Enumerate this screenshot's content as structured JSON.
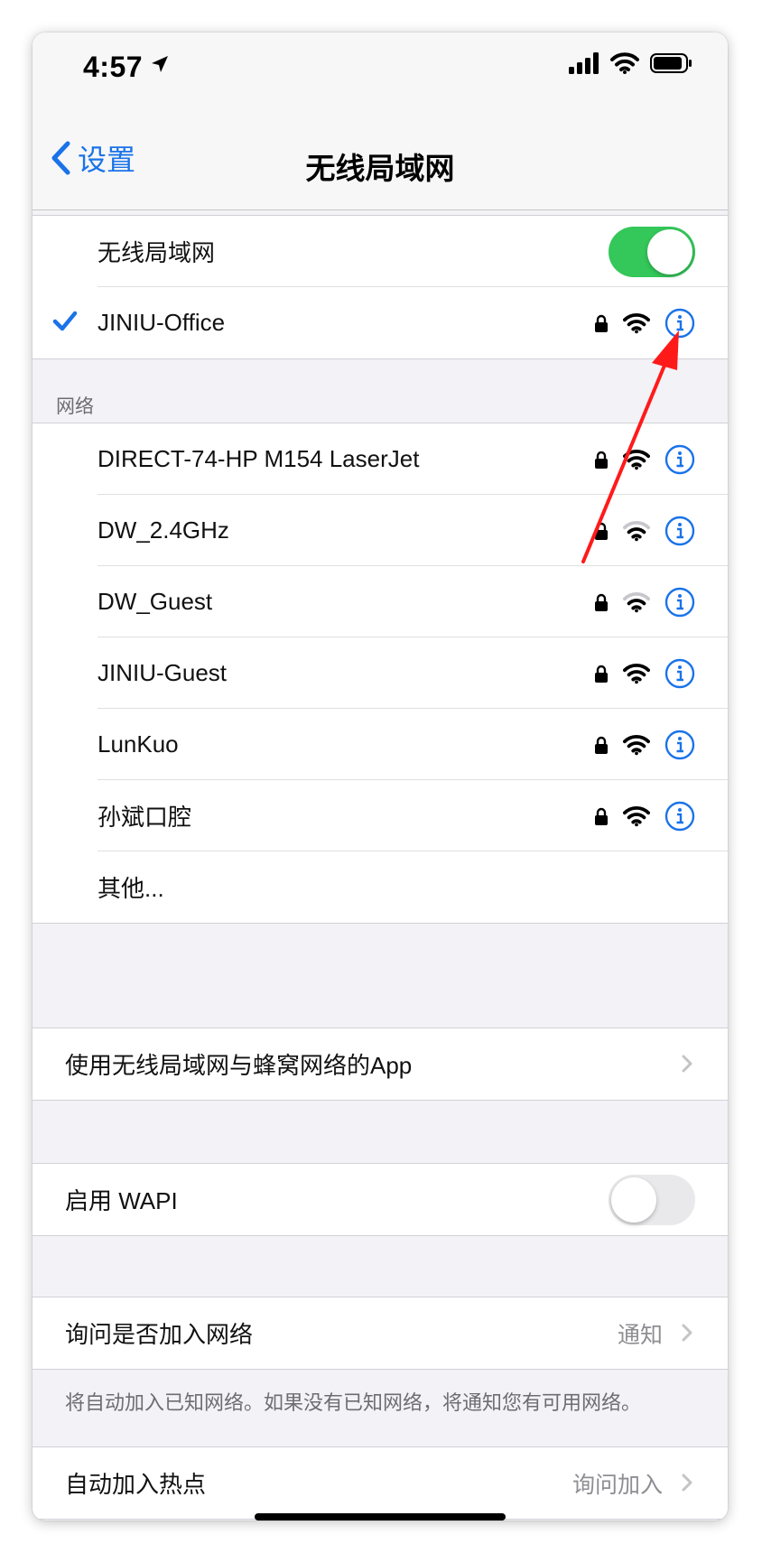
{
  "status_bar": {
    "time": "4:57"
  },
  "nav": {
    "back_label": "设置",
    "title": "无线局域网"
  },
  "wifi_toggle": {
    "label": "无线局域网",
    "state": "on"
  },
  "connected": {
    "name": "JINIU-Office"
  },
  "networks_section": {
    "header": "网络"
  },
  "networks": [
    {
      "name": "DIRECT-74-HP M154 LaserJet",
      "signal": "full"
    },
    {
      "name": "DW_2.4GHz",
      "signal": "weak"
    },
    {
      "name": "DW_Guest",
      "signal": "weak"
    },
    {
      "name": "JINIU-Guest",
      "signal": "full"
    },
    {
      "name": "LunKuo",
      "signal": "full"
    },
    {
      "name": "孙斌口腔",
      "signal": "full"
    }
  ],
  "other": {
    "label": "其他..."
  },
  "apps_row": {
    "label": "使用无线局域网与蜂窝网络的App"
  },
  "wapi": {
    "label": "启用 WAPI",
    "state": "off"
  },
  "ask_join": {
    "label": "询问是否加入网络",
    "value": "通知",
    "footer": "将自动加入已知网络。如果没有已知网络，将通知您有可用网络。"
  },
  "auto_hotspot": {
    "label": "自动加入热点",
    "value": "询问加入"
  },
  "colors": {
    "accent": "#1a73e8",
    "toggle_on": "#34c759",
    "annotation": "#ff1a1a"
  }
}
